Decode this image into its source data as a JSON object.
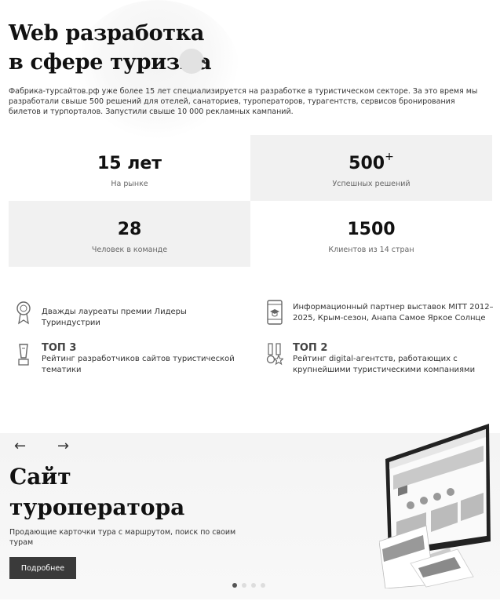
{
  "hero": {
    "title_line1": "Web разработка",
    "title_line2": "в сфере туризма",
    "intro": "Фабрика-турсайтов.рф уже более 15 лет специализируется на разработке в туристическом секторе. За это время мы разработали свыше 500 решений для отелей, санаториев, туроператоров, турагентств, сервисов бронирования билетов и турпорталов. Запустили свыше 10 000 рекламных кампаний."
  },
  "stats": [
    {
      "value": "15 лет",
      "sup": "",
      "label": "На рынке"
    },
    {
      "value": "500",
      "sup": "+",
      "label": "Успешных решений"
    },
    {
      "value": "28",
      "sup": "",
      "label": "Человек в команде"
    },
    {
      "value": "1500",
      "sup": "",
      "label": "Клиентов из 14 стран"
    }
  ],
  "awards": [
    {
      "icon": "medal-icon",
      "head": "",
      "text": "Дважды лауреаты премии Лидеры Туриндустрии"
    },
    {
      "icon": "mobile-graduation-icon",
      "head": "",
      "text": "Информационный партнер выставок MITT 2012–2025, Крым-сезон, Анапа Самое Яркое Солнце"
    },
    {
      "icon": "trophy-icon",
      "head": "ТОП 3",
      "text": "Рейтинг разработчиков сайтов туристической тематики"
    },
    {
      "icon": "medals-icon",
      "head": "ТОП 2",
      "text": "Рейтинг digital-агентств, работающих с крупнейшими туристическими компаниями"
    }
  ],
  "slider": {
    "prev": "←",
    "next": "→",
    "title_line1": "Сайт",
    "title_line2": "туроператора",
    "description": "Продающие карточки тура с маршрутом, поиск по своим турам",
    "button": "Подробнее",
    "active_dot": 0,
    "dot_count": 4
  }
}
